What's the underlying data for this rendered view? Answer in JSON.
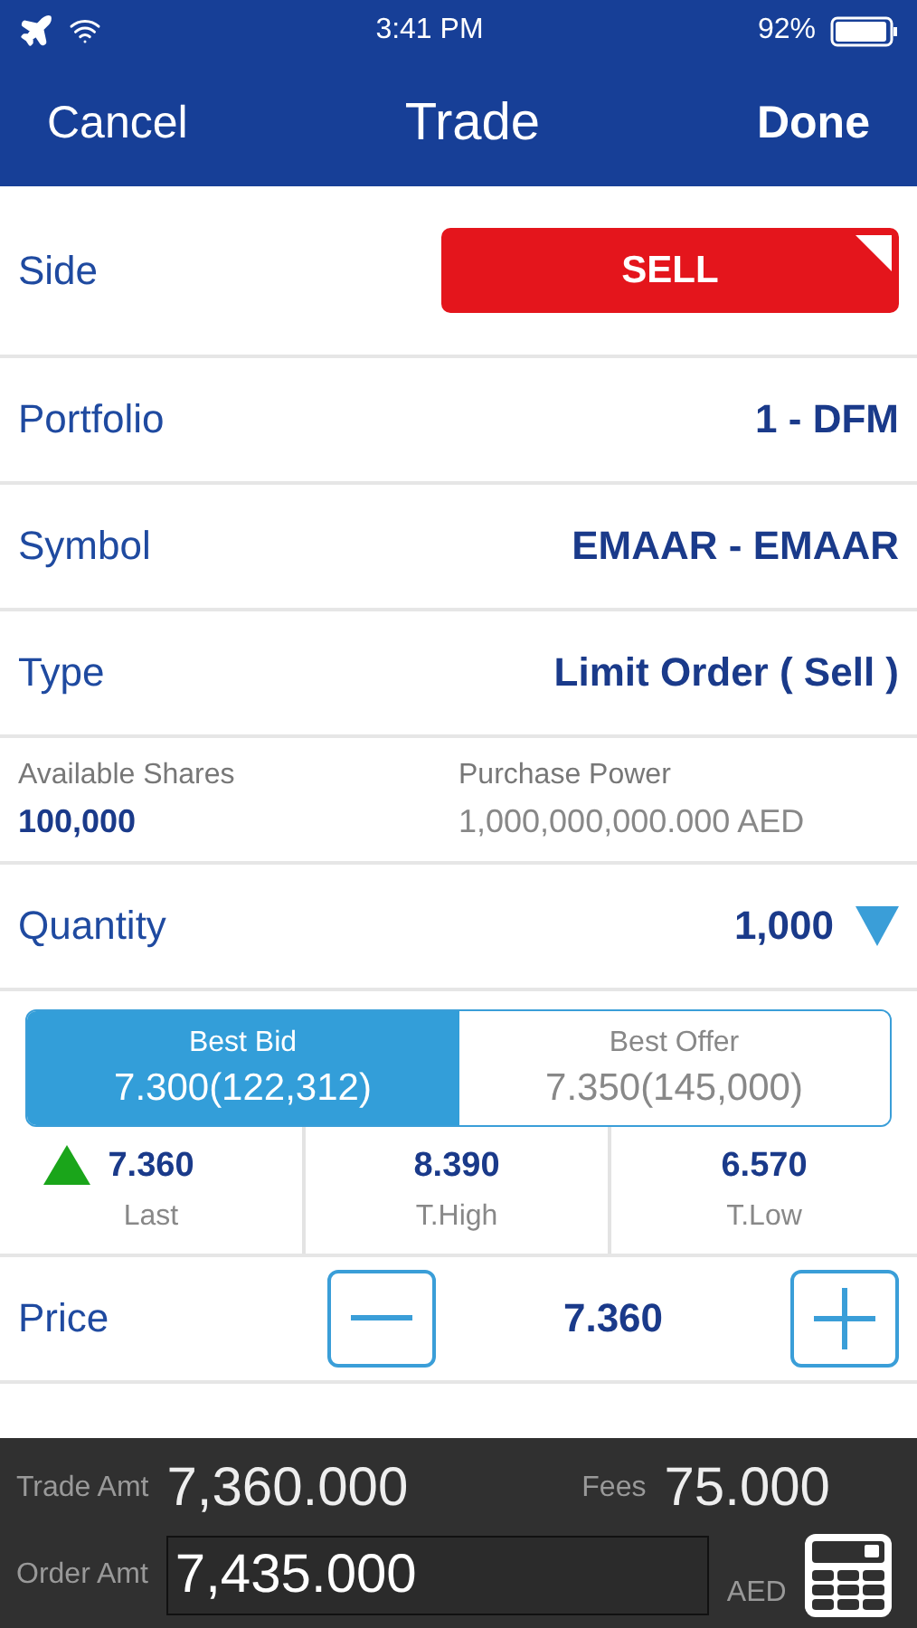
{
  "status_bar": {
    "time": "3:41 PM",
    "battery": "92%"
  },
  "nav": {
    "cancel": "Cancel",
    "title": "Trade",
    "done": "Done"
  },
  "side": {
    "label": "Side",
    "value": "SELL"
  },
  "rows": [
    {
      "label": "Portfolio",
      "value": "1 - DFM"
    },
    {
      "label": "Symbol",
      "value": "EMAAR - EMAAR"
    },
    {
      "label": "Type",
      "value": "Limit Order ( Sell )"
    }
  ],
  "balances": [
    {
      "label": "Available Shares",
      "value": "100,000",
      "kind": "highlight"
    },
    {
      "label": "Purchase Power",
      "value": "1,000,000,000.000 AED",
      "kind": "muted"
    }
  ],
  "quantity": {
    "label": "Quantity",
    "value": "1,000"
  },
  "book_tabs": [
    {
      "label": "Best Bid",
      "value": "7.300(122,312)",
      "selected": true
    },
    {
      "label": "Best Offer",
      "value": "7.350(145,000)",
      "selected": false
    }
  ],
  "stats": [
    {
      "value": "7.360",
      "label": "Last",
      "rising": true
    },
    {
      "value": "8.390",
      "label": "T.High"
    },
    {
      "value": "6.570",
      "label": "T.Low"
    }
  ],
  "price": {
    "label": "Price",
    "value": "7.360"
  },
  "footer": {
    "trade_label": "Trade Amt",
    "trade_value": "7,360.000",
    "fees_label": "Fees",
    "fees_value": "75.000",
    "order_label": "Order Amt",
    "order_value": "7,435.000",
    "currency": "AED"
  }
}
